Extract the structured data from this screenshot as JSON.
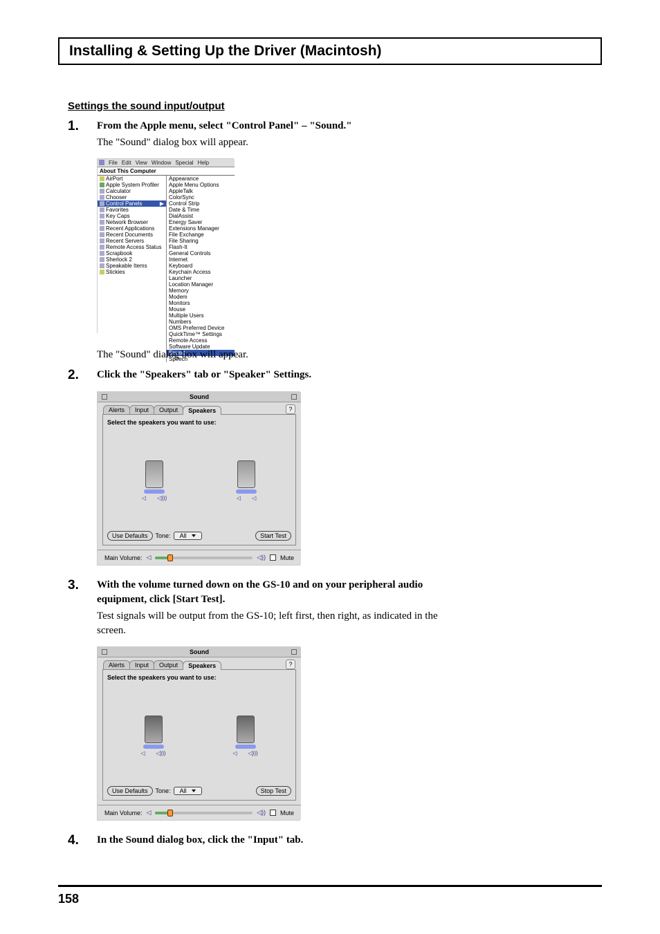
{
  "page": {
    "title": "Installing & Setting Up the Driver (Macintosh)",
    "subheading": "Settings the sound input/output",
    "number": "158"
  },
  "steps": [
    {
      "num": "1.",
      "instruction": "From the Apple menu, select \"Control Panel\" – \"Sound.\"",
      "note": "The \"Sound\" dialog box will appear."
    },
    {
      "num": "",
      "instruction": "",
      "note": "The \"Sound\" dialog box will appear."
    },
    {
      "num": "2.",
      "instruction": "Click the \"Speakers\" tab or \"Speaker\" Settings.",
      "note": ""
    },
    {
      "num": "3.",
      "instruction": "With the volume turned down on the GS-10 and on your peripheral audio equipment, click [Start Test].",
      "note": "Test signals will be output from the GS-10; left first, then right, as indicated in the screen."
    },
    {
      "num": "4.",
      "instruction": "In the Sound dialog box, click the \"Input\" tab.",
      "note": ""
    }
  ],
  "apple_menu": {
    "menubar": [
      "File",
      "Edit",
      "View",
      "Window",
      "Special",
      "Help"
    ],
    "title": "About This Computer",
    "left": [
      "AirPort",
      "Apple System Profiler",
      "Calculator",
      "Chooser",
      "Control Panels",
      "Favorites",
      "Key Caps",
      "Network Browser",
      "Recent Applications",
      "Recent Documents",
      "Recent Servers",
      "Remote Access Status",
      "Scrapbook",
      "Sherlock 2",
      "Speakable Items",
      "Stickies"
    ],
    "right": [
      "Appearance",
      "Apple Menu Options",
      "AppleTalk",
      "ColorSync",
      "Control Strip",
      "Date & Time",
      "DialAssist",
      "Energy Saver",
      "Extensions Manager",
      "File Exchange",
      "File Sharing",
      "Flash-It",
      "General Controls",
      "Internet",
      "Keyboard",
      "Keychain Access",
      "Launcher",
      "Location Manager",
      "Memory",
      "Modem",
      "Monitors",
      "Mouse",
      "Multiple Users",
      "Numbers",
      "OMS Preferred Device",
      "QuickTime™ Settings",
      "Remote Access",
      "Software Update",
      "Sound",
      "Speech"
    ],
    "hl_left": "Control Panels",
    "hl_right": "Sound"
  },
  "sound_dialog": {
    "title": "Sound",
    "tabs": [
      "Alerts",
      "Input",
      "Output",
      "Speakers"
    ],
    "active": "Speakers",
    "select_label": "Select the speakers you want to use:",
    "use_defaults": "Use Defaults",
    "tone_label": "Tone:",
    "tone_value": "All",
    "start_test": "Start Test",
    "stop_test": "Stop Test",
    "main_volume": "Main Volume:",
    "mute": "Mute",
    "help": "?"
  }
}
